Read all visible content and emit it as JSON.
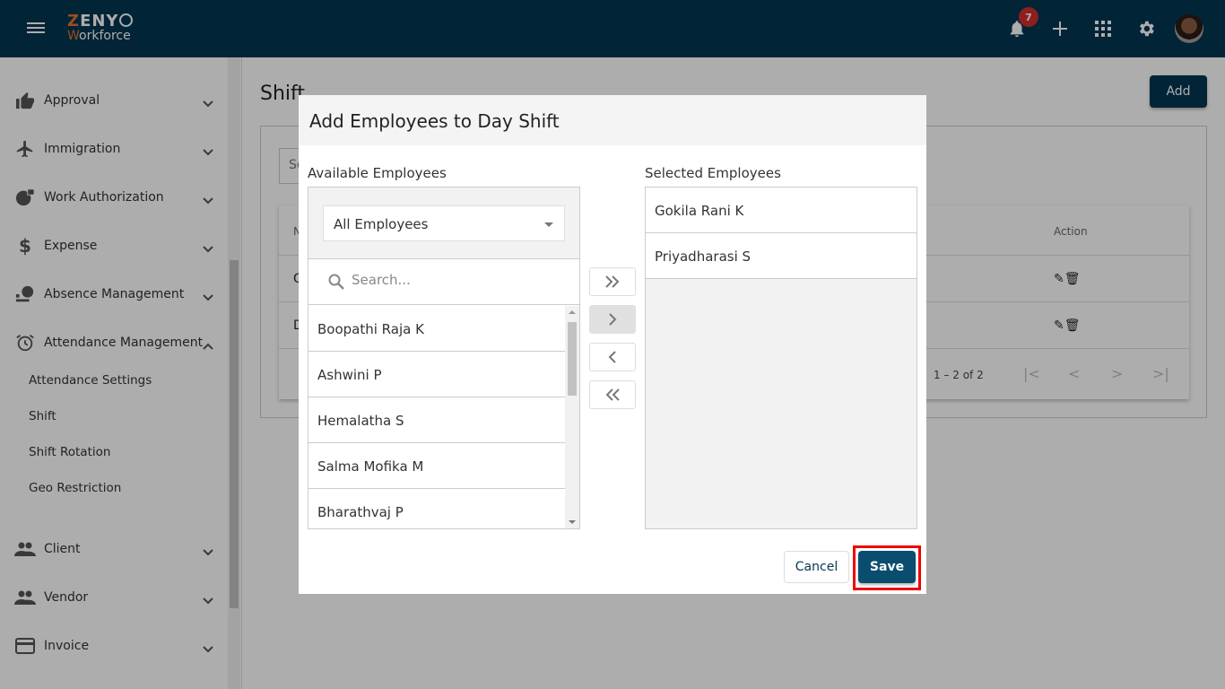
{
  "header": {
    "logo_top": "ZENY",
    "logo_top_first": "Z",
    "logo_top_rest": "ENY",
    "logo_bottom_first": "W",
    "logo_bottom_rest": "orkforce",
    "notification_count": "7",
    "colors": {
      "brand": "#033652",
      "accent": "#e8702a",
      "badge": "#d32f2f"
    }
  },
  "sidebar": {
    "items": [
      {
        "label": "Approval",
        "icon": "thumb-up-icon",
        "expanded": false
      },
      {
        "label": "Immigration",
        "icon": "airplane-icon",
        "expanded": false
      },
      {
        "label": "Work Authorization",
        "icon": "globe-lock-icon",
        "expanded": false
      },
      {
        "label": "Expense",
        "icon": "dollar-icon",
        "expanded": false
      },
      {
        "label": "Absence Management",
        "icon": "absence-icon",
        "expanded": false
      },
      {
        "label": "Attendance Management",
        "icon": "alarm-clock-icon",
        "expanded": true
      },
      {
        "label": "Client",
        "icon": "people-icon",
        "expanded": false
      },
      {
        "label": "Vendor",
        "icon": "people-icon",
        "expanded": false
      },
      {
        "label": "Invoice",
        "icon": "credit-card-icon",
        "expanded": false
      }
    ],
    "subitems": [
      "Attendance Settings",
      "Shift",
      "Shift Rotation",
      "Geo Restriction"
    ]
  },
  "page": {
    "title": "Shift",
    "add_label": "Add",
    "search_placeholder": "Se",
    "table": {
      "headers": [
        "N",
        "Action"
      ],
      "rows": [
        {
          "name": "G"
        },
        {
          "name": "D"
        }
      ],
      "pagination": "1 – 2 of 2"
    }
  },
  "modal": {
    "title": "Add Employees to Day Shift",
    "available_label": "Available Employees",
    "selected_label": "Selected Employees",
    "filter_value": "All Employees",
    "search_placeholder": "Search...",
    "available": [
      "Boopathi Raja K",
      "Ashwini P",
      "Hemalatha S",
      "Salma Mofika M",
      "Bharathvaj P"
    ],
    "selected": [
      "Gokila Rani K",
      "Priyadharasi S"
    ],
    "transfer_buttons": [
      "move-all-right",
      "move-right",
      "move-left",
      "move-all-left"
    ],
    "cancel_label": "Cancel",
    "save_label": "Save"
  }
}
